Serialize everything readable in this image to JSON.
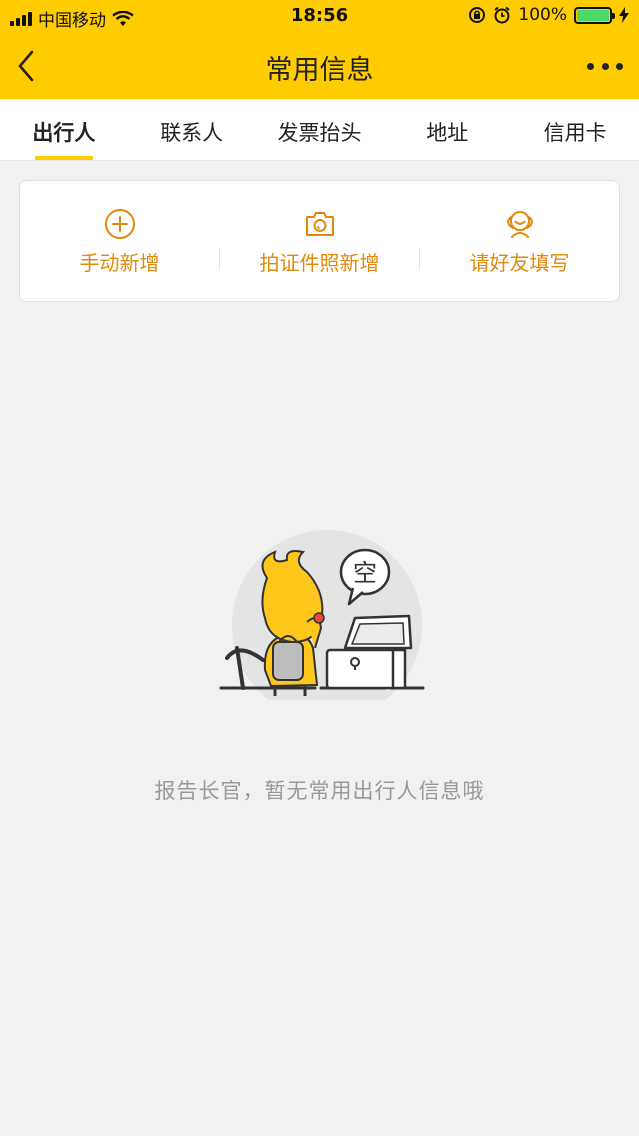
{
  "status_bar": {
    "carrier": "中国移动",
    "time": "18:56",
    "battery": "100%"
  },
  "header": {
    "title": "常用信息",
    "back_icon": "chevron-left-icon",
    "more_icon": "more-dots-icon"
  },
  "tabs": [
    {
      "label": "出行人",
      "active": true
    },
    {
      "label": "联系人",
      "active": false
    },
    {
      "label": "发票抬头",
      "active": false
    },
    {
      "label": "地址",
      "active": false
    },
    {
      "label": "信用卡",
      "active": false
    }
  ],
  "actions": [
    {
      "label": "手动新增",
      "icon": "plus-circle-icon"
    },
    {
      "label": "拍证件照新增",
      "icon": "camera-icon"
    },
    {
      "label": "请好友填写",
      "icon": "friend-icon"
    }
  ],
  "empty": {
    "bubble_text": "空",
    "message": "报告长官，暂无常用出行人信息哦"
  },
  "colors": {
    "brand_yellow": "#ffcc00",
    "accent_orange": "#e08a0d",
    "background": "#f1f1f1"
  }
}
